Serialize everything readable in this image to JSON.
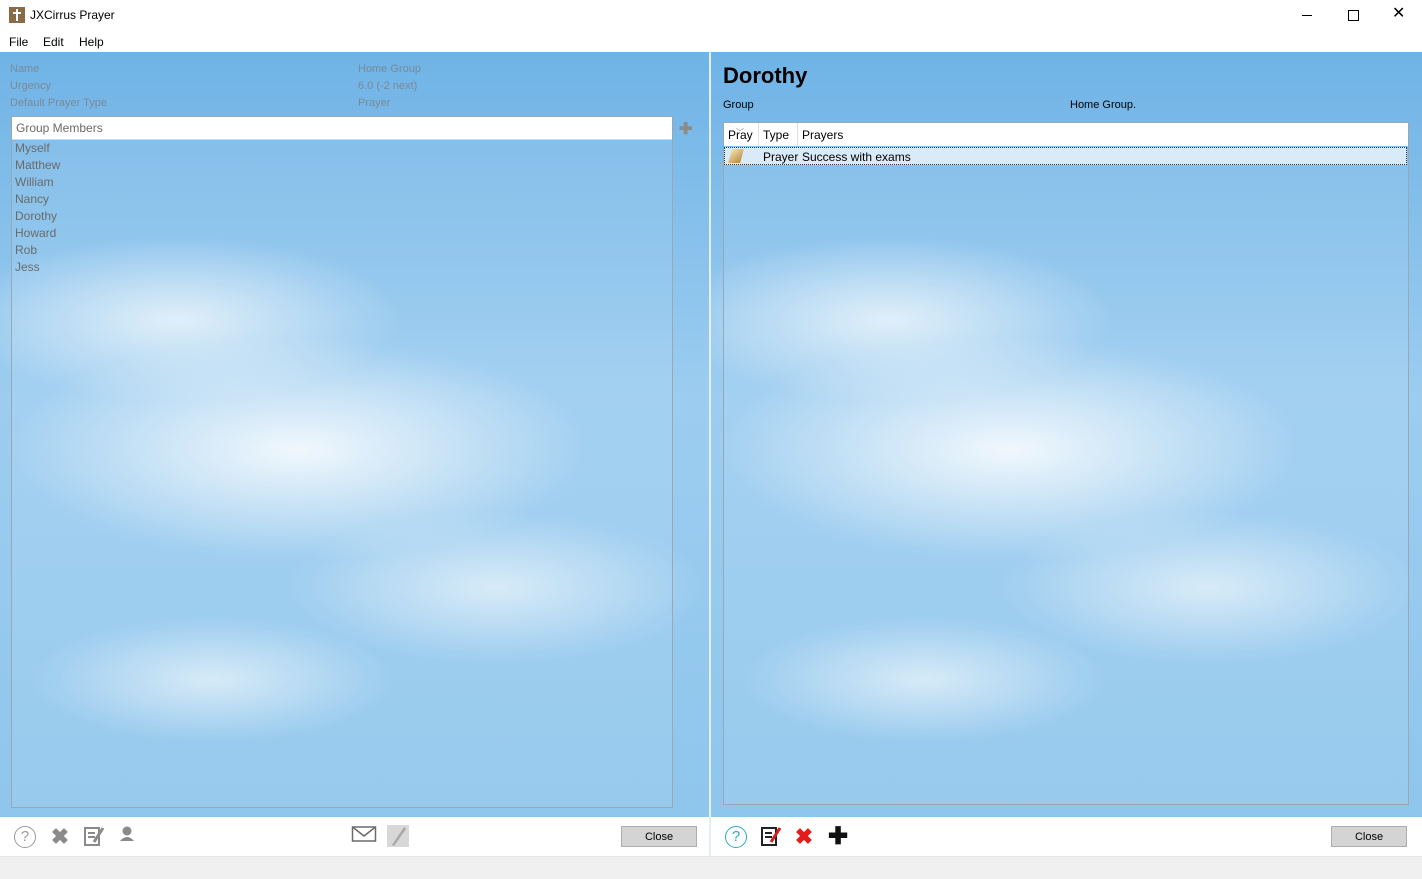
{
  "window": {
    "title": "JXCirrus Prayer",
    "minimize": "—",
    "maximize": "☐",
    "close": "✕"
  },
  "menu": [
    {
      "label": "File"
    },
    {
      "label": "Edit"
    },
    {
      "label": "Help"
    }
  ],
  "group_info": {
    "name_label": "Name",
    "name_value": "Home Group",
    "urgency_label": "Urgency",
    "urgency_value": "6.0 (-2 next)",
    "prayer_type_label": "Default Prayer Type",
    "prayer_type_value": "Prayer"
  },
  "members": {
    "header": "Group Members",
    "items": [
      {
        "label": "Myself"
      },
      {
        "label": "Matthew"
      },
      {
        "label": "William"
      },
      {
        "label": "Nancy"
      },
      {
        "label": "Dorothy"
      },
      {
        "label": "Howard"
      },
      {
        "label": "Rob"
      },
      {
        "label": "Jess"
      }
    ]
  },
  "person": {
    "name": "Dorothy",
    "group_label": "Group",
    "group_value": "Home Group."
  },
  "prayers_table": {
    "columns": [
      "Pray",
      "Type",
      "Prayers"
    ],
    "rows": [
      {
        "type": "Prayer",
        "text": "Success with exams"
      }
    ]
  },
  "left_toolbar": {
    "close_label": "Close"
  },
  "right_toolbar": {
    "close_label": "Close"
  },
  "colors": {
    "delete_active": "#e31b1b",
    "icon_gray": "#8a8a8a",
    "help_teal": "#2aa8c8"
  }
}
